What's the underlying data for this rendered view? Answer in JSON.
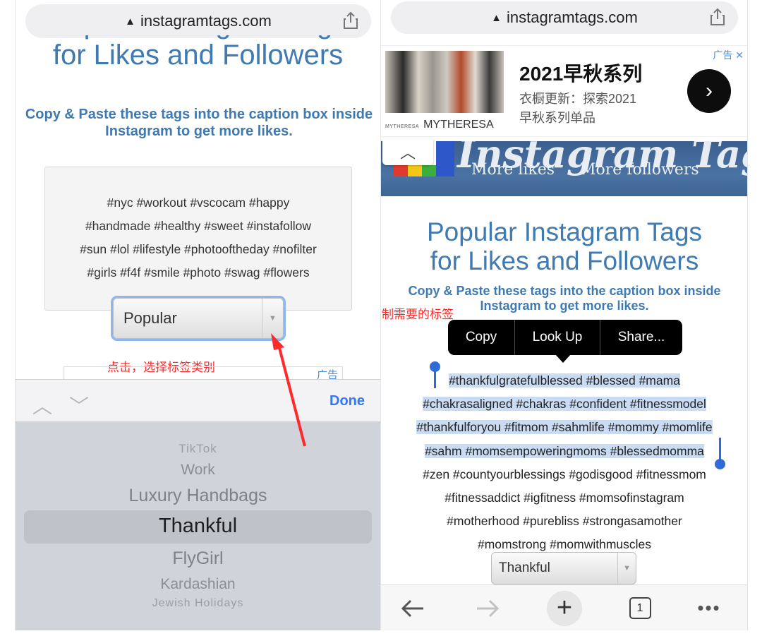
{
  "left": {
    "url": "instagramtags.com",
    "title_line1": "Popular Instagram Tags",
    "title_line2": "for Likes and Followers",
    "subtitle_line1": "Copy & Paste these tags into the caption box inside",
    "subtitle_line2": "Instagram to get more likes.",
    "tag_lines": [
      "#nyc #workout #vscocam #happy",
      "#handmade #healthy #sweet #instafollow",
      "#sun #lol #lifestyle #photooftheday #nofilter",
      "#girls #f4f #smile #photo #swag #flowers"
    ],
    "select_value": "Popular",
    "annotation": "点击，选择标签类别",
    "ad_label": "广告",
    "done_label": "Done",
    "picker_items": [
      "TikTok",
      "Work",
      "Luxury Handbags",
      "Thankful",
      "FlyGirl",
      "Kardashian",
      "Jewish Holidays"
    ],
    "picker_selected": "Thankful"
  },
  "right": {
    "url": "instagramtags.com",
    "ad": {
      "label": "广告",
      "headline": "2021早秋系列",
      "desc_line1": "衣橱更新：探索2021",
      "desc_line2": "早秋系列单品",
      "brand": "MYTHERESA",
      "brand_small": "MYTHERESA"
    },
    "banner": {
      "title": "Instagram Tags",
      "sub1": "More likes",
      "sub2": "More followers"
    },
    "title_line1": "Popular Instagram Tags",
    "title_line2": "for Likes and Followers",
    "subtitle_line1": "Copy & Paste these tags into the caption box inside",
    "subtitle_line2": "Instagram to get more likes.",
    "annotation": "复制需要的标签",
    "callout": [
      "Copy",
      "Look Up",
      "Share..."
    ],
    "selected_lines": [
      "#thankfulgratefulblessed #blessed #mama",
      "#chakrasaligned #chakras #confident #fitnessmodel",
      "#thankfulforyou #fitmom #sahmlife #mommy #momlife",
      "#sahm #momsempoweringmoms #blessedmomma"
    ],
    "other_lines": [
      "#zen #countyourblessings #godisgood #fitnessmom",
      "#fitnessaddict  #igfitness #momsofinstagram",
      "#motherhood #purebliss #strongasamother",
      "#momstrong #momwithmuscles"
    ],
    "select_value": "Thankful",
    "tab_count": "1"
  },
  "colors": {
    "accent": "#3f7ab0",
    "annotation": "#ff2a2a",
    "selection": "#c9dcf3",
    "ios_blue": "#3478f6"
  }
}
